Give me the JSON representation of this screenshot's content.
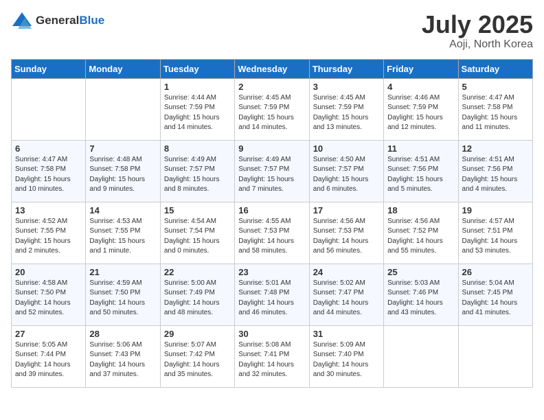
{
  "header": {
    "logo_general": "General",
    "logo_blue": "Blue",
    "month": "July 2025",
    "location": "Aoji, North Korea"
  },
  "columns": [
    "Sunday",
    "Monday",
    "Tuesday",
    "Wednesday",
    "Thursday",
    "Friday",
    "Saturday"
  ],
  "weeks": [
    [
      {
        "day": "",
        "content": ""
      },
      {
        "day": "",
        "content": ""
      },
      {
        "day": "1",
        "content": "Sunrise: 4:44 AM\nSunset: 7:59 PM\nDaylight: 15 hours\nand 14 minutes."
      },
      {
        "day": "2",
        "content": "Sunrise: 4:45 AM\nSunset: 7:59 PM\nDaylight: 15 hours\nand 14 minutes."
      },
      {
        "day": "3",
        "content": "Sunrise: 4:45 AM\nSunset: 7:59 PM\nDaylight: 15 hours\nand 13 minutes."
      },
      {
        "day": "4",
        "content": "Sunrise: 4:46 AM\nSunset: 7:59 PM\nDaylight: 15 hours\nand 12 minutes."
      },
      {
        "day": "5",
        "content": "Sunrise: 4:47 AM\nSunset: 7:58 PM\nDaylight: 15 hours\nand 11 minutes."
      }
    ],
    [
      {
        "day": "6",
        "content": "Sunrise: 4:47 AM\nSunset: 7:58 PM\nDaylight: 15 hours\nand 10 minutes."
      },
      {
        "day": "7",
        "content": "Sunrise: 4:48 AM\nSunset: 7:58 PM\nDaylight: 15 hours\nand 9 minutes."
      },
      {
        "day": "8",
        "content": "Sunrise: 4:49 AM\nSunset: 7:57 PM\nDaylight: 15 hours\nand 8 minutes."
      },
      {
        "day": "9",
        "content": "Sunrise: 4:49 AM\nSunset: 7:57 PM\nDaylight: 15 hours\nand 7 minutes."
      },
      {
        "day": "10",
        "content": "Sunrise: 4:50 AM\nSunset: 7:57 PM\nDaylight: 15 hours\nand 6 minutes."
      },
      {
        "day": "11",
        "content": "Sunrise: 4:51 AM\nSunset: 7:56 PM\nDaylight: 15 hours\nand 5 minutes."
      },
      {
        "day": "12",
        "content": "Sunrise: 4:51 AM\nSunset: 7:56 PM\nDaylight: 15 hours\nand 4 minutes."
      }
    ],
    [
      {
        "day": "13",
        "content": "Sunrise: 4:52 AM\nSunset: 7:55 PM\nDaylight: 15 hours\nand 2 minutes."
      },
      {
        "day": "14",
        "content": "Sunrise: 4:53 AM\nSunset: 7:55 PM\nDaylight: 15 hours\nand 1 minute."
      },
      {
        "day": "15",
        "content": "Sunrise: 4:54 AM\nSunset: 7:54 PM\nDaylight: 15 hours\nand 0 minutes."
      },
      {
        "day": "16",
        "content": "Sunrise: 4:55 AM\nSunset: 7:53 PM\nDaylight: 14 hours\nand 58 minutes."
      },
      {
        "day": "17",
        "content": "Sunrise: 4:56 AM\nSunset: 7:53 PM\nDaylight: 14 hours\nand 56 minutes."
      },
      {
        "day": "18",
        "content": "Sunrise: 4:56 AM\nSunset: 7:52 PM\nDaylight: 14 hours\nand 55 minutes."
      },
      {
        "day": "19",
        "content": "Sunrise: 4:57 AM\nSunset: 7:51 PM\nDaylight: 14 hours\nand 53 minutes."
      }
    ],
    [
      {
        "day": "20",
        "content": "Sunrise: 4:58 AM\nSunset: 7:50 PM\nDaylight: 14 hours\nand 52 minutes."
      },
      {
        "day": "21",
        "content": "Sunrise: 4:59 AM\nSunset: 7:50 PM\nDaylight: 14 hours\nand 50 minutes."
      },
      {
        "day": "22",
        "content": "Sunrise: 5:00 AM\nSunset: 7:49 PM\nDaylight: 14 hours\nand 48 minutes."
      },
      {
        "day": "23",
        "content": "Sunrise: 5:01 AM\nSunset: 7:48 PM\nDaylight: 14 hours\nand 46 minutes."
      },
      {
        "day": "24",
        "content": "Sunrise: 5:02 AM\nSunset: 7:47 PM\nDaylight: 14 hours\nand 44 minutes."
      },
      {
        "day": "25",
        "content": "Sunrise: 5:03 AM\nSunset: 7:46 PM\nDaylight: 14 hours\nand 43 minutes."
      },
      {
        "day": "26",
        "content": "Sunrise: 5:04 AM\nSunset: 7:45 PM\nDaylight: 14 hours\nand 41 minutes."
      }
    ],
    [
      {
        "day": "27",
        "content": "Sunrise: 5:05 AM\nSunset: 7:44 PM\nDaylight: 14 hours\nand 39 minutes."
      },
      {
        "day": "28",
        "content": "Sunrise: 5:06 AM\nSunset: 7:43 PM\nDaylight: 14 hours\nand 37 minutes."
      },
      {
        "day": "29",
        "content": "Sunrise: 5:07 AM\nSunset: 7:42 PM\nDaylight: 14 hours\nand 35 minutes."
      },
      {
        "day": "30",
        "content": "Sunrise: 5:08 AM\nSunset: 7:41 PM\nDaylight: 14 hours\nand 32 minutes."
      },
      {
        "day": "31",
        "content": "Sunrise: 5:09 AM\nSunset: 7:40 PM\nDaylight: 14 hours\nand 30 minutes."
      },
      {
        "day": "",
        "content": ""
      },
      {
        "day": "",
        "content": ""
      }
    ]
  ]
}
